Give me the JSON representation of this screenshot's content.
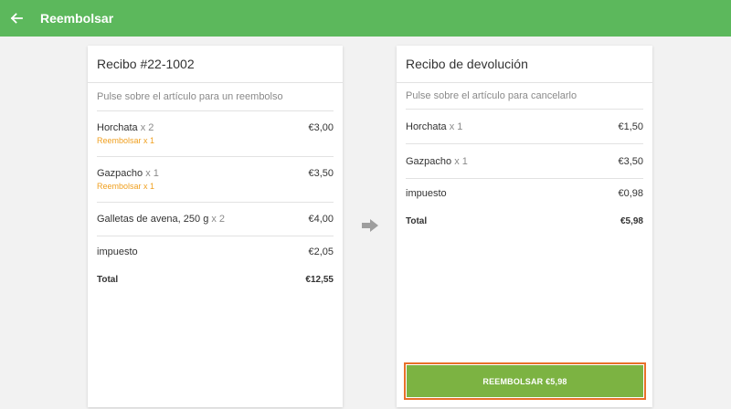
{
  "appbar": {
    "title": "Reembolsar",
    "back_icon": "arrow-left-icon",
    "color": "#5cb85c"
  },
  "receipt": {
    "title": "Recibo #22-1002",
    "hint": "Pulse sobre el artículo para un reembolso",
    "items": [
      {
        "name": "Horchata",
        "qty": "x 2",
        "price": "€3,00",
        "refund_note": "Reembolsar x 1"
      },
      {
        "name": "Gazpacho",
        "qty": "x 1",
        "price": "€3,50",
        "refund_note": "Reembolsar x 1"
      },
      {
        "name": "Galletas de avena, 250 g",
        "qty": "x 2",
        "price": "€4,00",
        "refund_note": ""
      }
    ],
    "tax_label": "impuesto",
    "tax_value": "€2,05",
    "total_label": "Total",
    "total_value": "€12,55"
  },
  "refund_receipt": {
    "title": "Recibo de devolución",
    "hint": "Pulse sobre el artículo para cancelarlo",
    "items": [
      {
        "name": "Horchata",
        "qty": "x 1",
        "price": "€1,50"
      },
      {
        "name": "Gazpacho",
        "qty": "x 1",
        "price": "€3,50"
      }
    ],
    "tax_label": "impuesto",
    "tax_value": "€0,98",
    "total_label": "Total",
    "total_value": "€5,98"
  },
  "transfer_icon": "arrow-right-icon",
  "refund_button": {
    "label": "REEMBOLSAR €5,98",
    "color": "#7cb342",
    "highlight_color": "#e8702a"
  }
}
